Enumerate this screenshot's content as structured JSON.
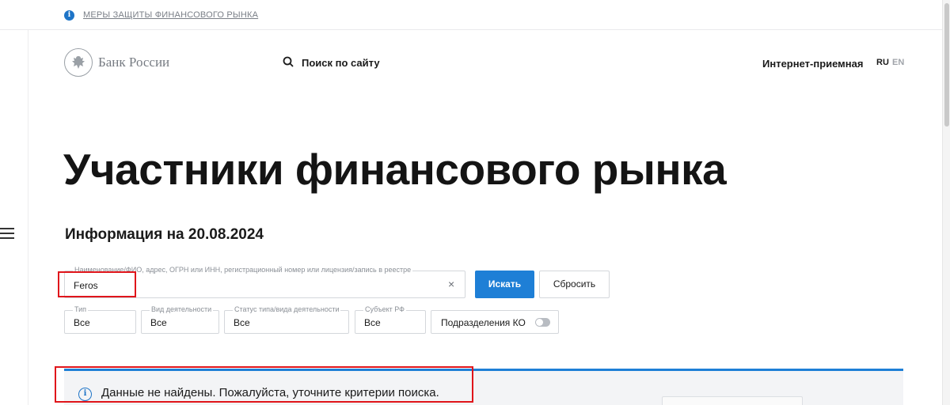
{
  "topbar": {
    "notice": "МЕРЫ ЗАЩИТЫ ФИНАНСОВОГО РЫНКА",
    "info_icon": "i"
  },
  "header": {
    "logo_text": "Банк России",
    "search_label": "Поиск по сайту",
    "reception": "Интернет-приемная",
    "lang_ru": "RU",
    "lang_en": "EN"
  },
  "main": {
    "title": "Участники финансового рынка",
    "subtitle": "Информация на 20.08.2024"
  },
  "search_form": {
    "query_legend": "Наименование/ФИО, адрес, ОГРН или ИНН, регистрационный номер или лицензия/запись в реестре",
    "query_value": "Feros",
    "clear": "×",
    "search_button": "Искать",
    "reset_button": "Сбросить",
    "filters": [
      {
        "legend": "Тип",
        "value": "Все"
      },
      {
        "legend": "Вид деятельности",
        "value": "Все"
      },
      {
        "legend": "Статус типа/вида деятельности",
        "value": "Все"
      },
      {
        "legend": "Субъект РФ",
        "value": "Все"
      }
    ],
    "branches_label": "Подразделения КО",
    "branches_toggle_on": false
  },
  "result": {
    "icon": "i",
    "message": "Данные не найдены. Пожалуйста, уточните критерии поиска."
  },
  "colors": {
    "accent": "#1e7fd6",
    "highlight": "#e0151b",
    "muted": "#7a7f87"
  }
}
